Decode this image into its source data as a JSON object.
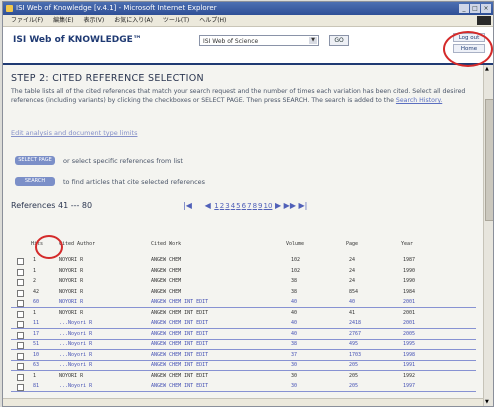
{
  "window": {
    "title": "ISI Web of Knowledge [v.4.1] - Microsoft Internet Explorer"
  },
  "menubar": {
    "items": [
      "ファイル(F)",
      "編集(E)",
      "表示(V)",
      "お気に入り(A)",
      "ツール(T)",
      "ヘルプ(H)"
    ]
  },
  "header": {
    "brand": "ISI Web of KNOWLEDGE™",
    "db_select": "ISI Web of Science",
    "go_label": "GO",
    "log_out": "Log out",
    "home": "Home"
  },
  "main": {
    "step_title": "STEP 2: CITED REFERENCE SELECTION",
    "description": "The table lists all of the cited references that match your search request and the number of times each variation has been cited. Select all desired references (including variants) by clicking the checkboxes or SELECT PAGE. Then press SEARCH. The search is added to the",
    "history_link": "Search History.",
    "back_link": "Edit analysis and document type limits",
    "select_page_btn": "SELECT PAGE",
    "select_page_text": "or select specific references from list",
    "search_btn": "SEARCH",
    "search_text": "to find articles that cite selected references",
    "refs_label": "References 41 --- 80",
    "pager": {
      "first": "|◀",
      "prev": "◀",
      "pages": [
        "1",
        "2",
        "3",
        "4",
        "5",
        "6",
        "7",
        "8",
        "9",
        "10"
      ],
      "next": "▶",
      "next10": "▶▶",
      "last": "▶|"
    }
  },
  "table": {
    "headers": {
      "hits": "Hits",
      "author": "Cited Author",
      "work": "Cited Work",
      "volume": "Volume",
      "page": "Page",
      "year": "Year"
    },
    "rows": [
      {
        "hits": "1",
        "author": "NOYORI R",
        "work": "ANGEW CHEM",
        "volume": "102",
        "page": "24",
        "year": "1987",
        "hl": false
      },
      {
        "hits": "1",
        "author": "NOYORI R",
        "work": "ANGEW CHEM",
        "volume": "102",
        "page": "24",
        "year": "1990",
        "hl": false
      },
      {
        "hits": "2",
        "author": "NOYORI R",
        "work": "ANGEW CHEM",
        "volume": "38",
        "page": "24",
        "year": "1990",
        "hl": false
      },
      {
        "hits": "42",
        "author": "NOYORI R",
        "work": "ANGEW CHEM",
        "volume": "38",
        "page": "854",
        "year": "1984",
        "hl": false
      },
      {
        "hits": "60",
        "author": "NOYORI R",
        "work": "ANGEW CHEM INT EDIT",
        "volume": "40",
        "page": "40",
        "year": "2001",
        "hl": true
      },
      {
        "hits": "1",
        "author": "NOYORI R",
        "work": "ANGEW CHEM INT EDIT",
        "volume": "40",
        "page": "41",
        "year": "2001",
        "hl": false
      },
      {
        "hits": "11",
        "author": "...Noyori R",
        "work": "ANGEW CHEM INT EDIT",
        "volume": "40",
        "page": "2418",
        "year": "2001",
        "hl": true
      },
      {
        "hits": "17",
        "author": "...Noyori R",
        "work": "ANGEW CHEM INT EDIT",
        "volume": "40",
        "page": "2767",
        "year": "2005",
        "hl": true
      },
      {
        "hits": "51",
        "author": "...Noyori R",
        "work": "ANGEW CHEM INT EDIT",
        "volume": "38",
        "page": "495",
        "year": "1995",
        "hl": true
      },
      {
        "hits": "10",
        "author": "...Noyori R",
        "work": "ANGEW CHEM INT EDIT",
        "volume": "37",
        "page": "1703",
        "year": "1998",
        "hl": true
      },
      {
        "hits": "63",
        "author": "...Noyori R",
        "work": "ANGEW CHEM INT EDIT",
        "volume": "30",
        "page": "205",
        "year": "1991",
        "hl": true
      },
      {
        "hits": "1",
        "author": "NOYORI R",
        "work": "ANGEW CHEM INT EDIT",
        "volume": "30",
        "page": "205",
        "year": "1992",
        "hl": false
      },
      {
        "hits": "81",
        "author": "...Noyori R",
        "work": "ANGEW CHEM INT EDIT",
        "volume": "30",
        "page": "205",
        "year": "1997",
        "hl": true
      }
    ]
  },
  "colors": {
    "accent": "#1f3a73",
    "link": "#5060b8",
    "annotation": "#d42a2a"
  }
}
